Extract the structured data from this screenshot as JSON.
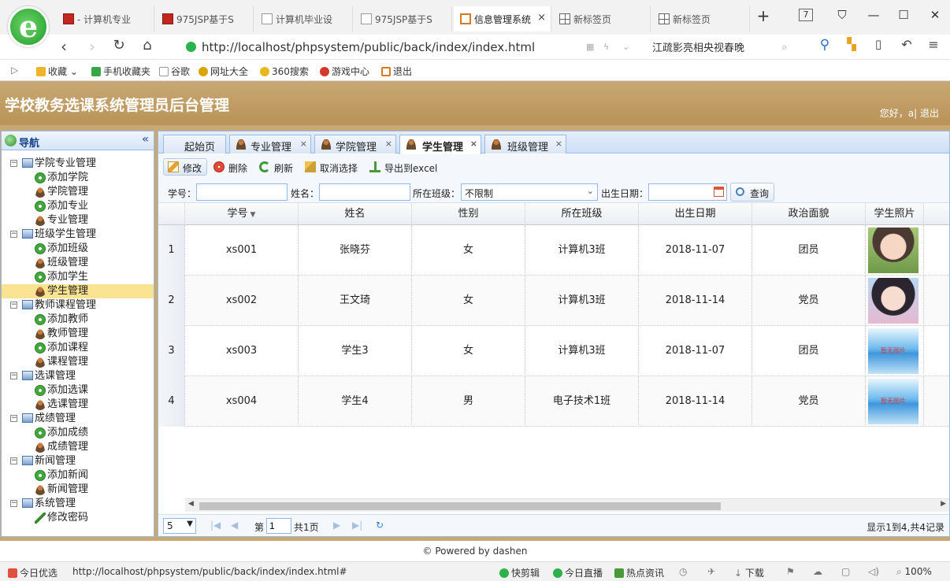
{
  "browser": {
    "tabs": [
      {
        "label": "- 计算机专业",
        "icon": "red-square-icon"
      },
      {
        "label": "975JSP基于S",
        "icon": "red-square-icon"
      },
      {
        "label": "计算机毕业设",
        "icon": "document-icon"
      },
      {
        "label": "975JSP基于S",
        "icon": "document-icon"
      },
      {
        "label": "信息管理系统",
        "icon": "orange-app-icon",
        "active": true
      },
      {
        "label": "新标签页",
        "icon": "grid-icon"
      },
      {
        "label": "新标签页",
        "icon": "grid-icon"
      }
    ],
    "tab_count": "7",
    "url": "http://localhost/phpsystem/public/back/index/index.html",
    "search_news": "江疏影亮相央视春晚",
    "bookmarks": [
      "收藏",
      "手机收藏夹",
      "谷歌",
      "网址大全",
      "360搜索",
      "游戏中心",
      "退出"
    ]
  },
  "app": {
    "title": "学校教务选课系统管理员后台管理",
    "greeting": "您好，a| 退出",
    "footer": "© Powered by dashen"
  },
  "sidebar": {
    "title": "导航",
    "groups": [
      {
        "label": "学院专业管理",
        "items": [
          {
            "label": "添加学院",
            "icon": "add"
          },
          {
            "label": "学院管理",
            "icon": "user"
          },
          {
            "label": "添加专业",
            "icon": "add"
          },
          {
            "label": "专业管理",
            "icon": "user"
          }
        ]
      },
      {
        "label": "班级学生管理",
        "items": [
          {
            "label": "添加班级",
            "icon": "add"
          },
          {
            "label": "班级管理",
            "icon": "user"
          },
          {
            "label": "添加学生",
            "icon": "add"
          },
          {
            "label": "学生管理",
            "icon": "user",
            "selected": true
          }
        ]
      },
      {
        "label": "教师课程管理",
        "items": [
          {
            "label": "添加教师",
            "icon": "add"
          },
          {
            "label": "教师管理",
            "icon": "user"
          },
          {
            "label": "添加课程",
            "icon": "add"
          },
          {
            "label": "课程管理",
            "icon": "user"
          }
        ]
      },
      {
        "label": "选课管理",
        "items": [
          {
            "label": "添加选课",
            "icon": "add"
          },
          {
            "label": "选课管理",
            "icon": "user"
          }
        ]
      },
      {
        "label": "成绩管理",
        "items": [
          {
            "label": "添加成绩",
            "icon": "add"
          },
          {
            "label": "成绩管理",
            "icon": "user"
          }
        ]
      },
      {
        "label": "新闻管理",
        "items": [
          {
            "label": "添加新闻",
            "icon": "add"
          },
          {
            "label": "新闻管理",
            "icon": "user"
          }
        ]
      },
      {
        "label": "系统管理",
        "items": [
          {
            "label": "修改密码",
            "icon": "pen"
          }
        ]
      }
    ]
  },
  "main": {
    "tabs": [
      "起始页",
      "专业管理",
      "学院管理",
      "学生管理",
      "班级管理"
    ],
    "active_tab": "学生管理",
    "toolbar": {
      "edit": "修改",
      "delete": "删除",
      "refresh": "刷新",
      "cancel_select": "取消选择",
      "export": "导出到excel"
    },
    "search": {
      "student_no_label": "学号：",
      "student_no_value": "",
      "name_label": "姓名：",
      "name_value": "",
      "class_label": "所在班级：",
      "class_value": "不限制",
      "birth_label": "出生日期：",
      "birth_value": "",
      "query_button": "查询"
    },
    "columns": [
      "学号",
      "姓名",
      "性别",
      "所在班级",
      "出生日期",
      "政治面貌",
      "学生照片"
    ],
    "rows": [
      {
        "num": "1",
        "no": "xs001",
        "name": "张晓芬",
        "gender": "女",
        "class": "计算机3班",
        "birth": "2018-11-07",
        "political": "团员",
        "photo": "student-photo-1"
      },
      {
        "num": "2",
        "no": "xs002",
        "name": "王文琦",
        "gender": "女",
        "class": "计算机3班",
        "birth": "2018-11-14",
        "political": "党员",
        "photo": "student-photo-2"
      },
      {
        "num": "3",
        "no": "xs003",
        "name": "学生3",
        "gender": "女",
        "class": "计算机3班",
        "birth": "2018-11-07",
        "political": "团员",
        "photo": "暂无图片"
      },
      {
        "num": "4",
        "no": "xs004",
        "name": "学生4",
        "gender": "男",
        "class": "电子技术1班",
        "birth": "2018-11-14",
        "political": "党员",
        "photo": "暂无图片"
      }
    ],
    "pager": {
      "page_size": "5",
      "page_label": "第",
      "page_value": "1",
      "total_pages": "共1页",
      "info": "显示1到4,共4记录"
    }
  },
  "statusbar": {
    "left": "今日优选",
    "url": "http://localhost/phpsystem/public/back/index/index.html#",
    "items": [
      "快剪辑",
      "今日直播",
      "热点资讯",
      "下载",
      "100%"
    ]
  }
}
